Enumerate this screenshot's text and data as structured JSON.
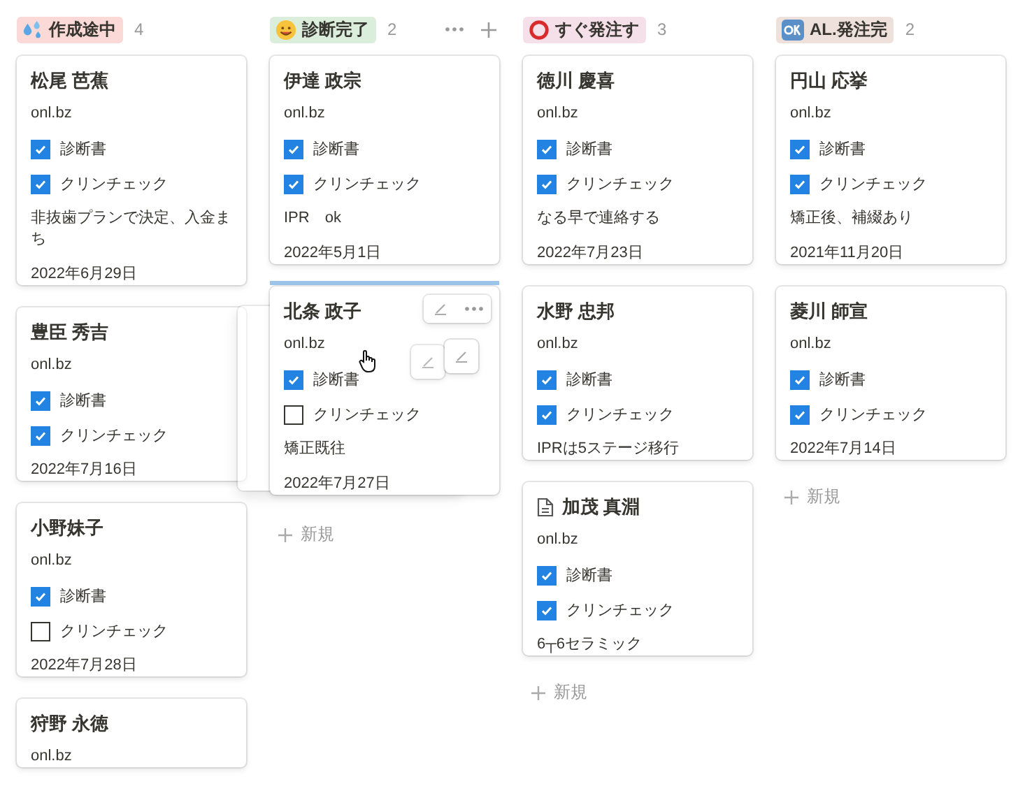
{
  "columns": [
    {
      "label": "作成途中",
      "color": "#fbd9d6",
      "count": "4",
      "hovered": false,
      "cards": [
        {
          "title": "松尾 芭蕉",
          "doc_icon": false,
          "hovered": false,
          "drop_above": false,
          "site": "onl.bz",
          "checks": [
            {
              "label": "診断書",
              "checked": true
            },
            {
              "label": "クリンチェック",
              "checked": true
            }
          ],
          "note": "非抜歯プランで決定、入金まち",
          "date": "2022年6月29日"
        },
        {
          "title": "豊臣 秀吉",
          "doc_icon": false,
          "hovered": false,
          "drop_above": false,
          "site": "onl.bz",
          "checks": [
            {
              "label": "診断書",
              "checked": true
            },
            {
              "label": "クリンチェック",
              "checked": true
            }
          ],
          "date": "2022年7月16日"
        },
        {
          "title": "小野妹子",
          "doc_icon": false,
          "hovered": false,
          "drop_above": false,
          "site": "onl.bz",
          "checks": [
            {
              "label": "診断書",
              "checked": true
            },
            {
              "label": "クリンチェック",
              "checked": false
            }
          ],
          "date": "2022年7月28日"
        },
        {
          "title": "狩野 永徳",
          "doc_icon": false,
          "hovered": false,
          "drop_above": false,
          "site": "onl.bz"
        }
      ]
    },
    {
      "label": "診断完了",
      "color": "#dbeddb",
      "count": "2",
      "hovered": true,
      "cards": [
        {
          "title": "伊達 政宗",
          "doc_icon": false,
          "hovered": false,
          "drop_above": false,
          "site": "onl.bz",
          "checks": [
            {
              "label": "診断書",
              "checked": true
            },
            {
              "label": "クリンチェック",
              "checked": true
            }
          ],
          "note": "IPR　ok",
          "date": "2022年5月1日"
        },
        {
          "title": "北条 政子",
          "doc_icon": false,
          "hovered": true,
          "drop_above": true,
          "site": "onl.bz",
          "checks": [
            {
              "label": "診断書",
              "checked": true
            },
            {
              "label": "クリンチェック",
              "checked": false
            }
          ],
          "note": "矯正既往",
          "date": "2022年7月27日"
        }
      ],
      "add": "新規"
    },
    {
      "label": "すぐ発注す",
      "color": "#f5e0e9",
      "count": "3",
      "hovered": false,
      "cards": [
        {
          "title": "徳川 慶喜",
          "doc_icon": false,
          "hovered": false,
          "drop_above": false,
          "site": "onl.bz",
          "checks": [
            {
              "label": "診断書",
              "checked": true
            },
            {
              "label": "クリンチェック",
              "checked": true
            }
          ],
          "note": "なる早で連絡する",
          "date": "2022年7月23日"
        },
        {
          "title": "水野 忠邦",
          "doc_icon": false,
          "hovered": false,
          "drop_above": false,
          "site": "onl.bz",
          "checks": [
            {
              "label": "診断書",
              "checked": true
            },
            {
              "label": "クリンチェック",
              "checked": true
            }
          ],
          "note": "IPRは5ステージ移行"
        },
        {
          "title": "加茂 真淵",
          "doc_icon": true,
          "hovered": false,
          "drop_above": false,
          "site": "onl.bz",
          "checks": [
            {
              "label": "診断書",
              "checked": true
            },
            {
              "label": "クリンチェック",
              "checked": true
            }
          ],
          "note": "6┬6セラミック"
        }
      ],
      "add": "新規"
    },
    {
      "label": "AL.発注完",
      "color": "#eee0da",
      "count": "2",
      "hovered": false,
      "cards": [
        {
          "title": "円山 応挙",
          "doc_icon": false,
          "hovered": false,
          "drop_above": false,
          "site": "onl.bz",
          "checks": [
            {
              "label": "診断書",
              "checked": true
            },
            {
              "label": "クリンチェック",
              "checked": true
            }
          ],
          "note": "矯正後、補綴あり",
          "date": "2021年11月20日"
        },
        {
          "title": "菱川 師宣",
          "doc_icon": false,
          "hovered": false,
          "drop_above": false,
          "site": "onl.bz",
          "checks": [
            {
              "label": "診断書",
              "checked": true
            },
            {
              "label": "クリンチェック",
              "checked": true
            }
          ],
          "date": "2022年7月14日"
        }
      ],
      "add": "新規"
    }
  ],
  "dragging": true
}
